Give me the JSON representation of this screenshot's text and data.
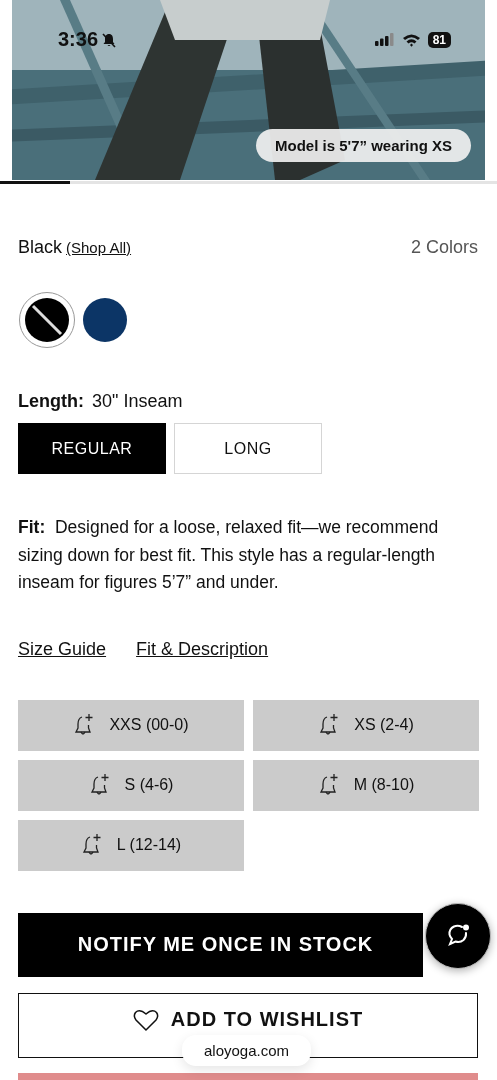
{
  "status_bar": {
    "time": "3:36",
    "silent": true,
    "battery": "81"
  },
  "hero": {
    "kind": "picture",
    "badge": "Model is 5'7” wearing XS",
    "carousel": {
      "level": 0.14
    }
  },
  "color_row": {
    "name": "Black",
    "link": "(Shop All)",
    "count": "2 Colors"
  },
  "swatches": [
    {
      "color": "#000000",
      "selected": true,
      "unavailable": true
    },
    {
      "color": "#0c3566",
      "selected": false,
      "unavailable": false
    }
  ],
  "length": {
    "label": "Length:",
    "value": "30\" Inseam",
    "options": [
      {
        "label": "REGULAR",
        "selected": true
      },
      {
        "label": "LONG",
        "selected": false
      }
    ]
  },
  "fit": {
    "label": "Fit:",
    "text": "Designed for a loose, relaxed fit—we recommend sizing down for best fit. This style has a regular-length inseam for figures 5’7” and under."
  },
  "links": [
    "Size Guide",
    "Fit & Description"
  ],
  "sizes": [
    {
      "label": "XXS (00-0)",
      "in_stock": false
    },
    {
      "label": "XS (2-4)",
      "in_stock": false
    },
    {
      "label": "S (4-6)",
      "in_stock": false
    },
    {
      "label": "M (8-10)",
      "in_stock": false
    },
    {
      "label": "L (12-14)",
      "in_stock": false
    }
  ],
  "notify_button": "NOTIFY ME ONCE IN STOCK",
  "wishlist_button": "ADD TO WISHLIST",
  "url_pill": "aloyoga.com"
}
